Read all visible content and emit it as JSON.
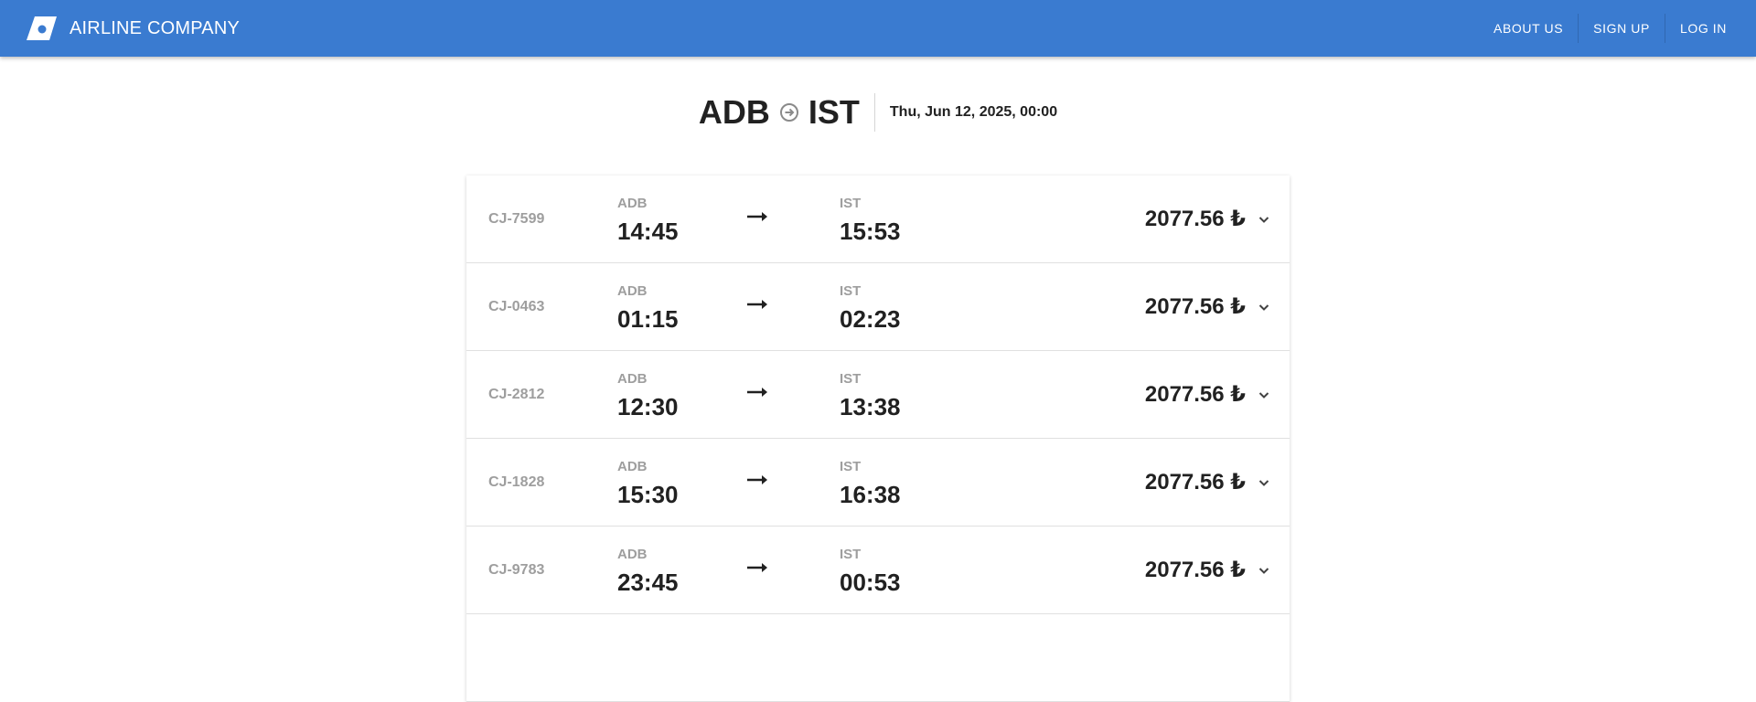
{
  "header": {
    "brand": "AIRLINE COMPANY",
    "nav": [
      "ABOUT US",
      "SIGN UP",
      "LOG IN"
    ],
    "color": "#3a7bd0"
  },
  "search": {
    "origin": "ADB",
    "destination": "IST",
    "date": "Thu, Jun 12, 2025, 00:00"
  },
  "flights": [
    {
      "code": "CJ-7599",
      "dep_airport": "ADB",
      "dep_time": "14:45",
      "arr_airport": "IST",
      "arr_time": "15:53",
      "price": "2077.56 ₺"
    },
    {
      "code": "CJ-0463",
      "dep_airport": "ADB",
      "dep_time": "01:15",
      "arr_airport": "IST",
      "arr_time": "02:23",
      "price": "2077.56 ₺"
    },
    {
      "code": "CJ-2812",
      "dep_airport": "ADB",
      "dep_time": "12:30",
      "arr_airport": "IST",
      "arr_time": "13:38",
      "price": "2077.56 ₺"
    },
    {
      "code": "CJ-1828",
      "dep_airport": "ADB",
      "dep_time": "15:30",
      "arr_airport": "IST",
      "arr_time": "16:38",
      "price": "2077.56 ₺"
    },
    {
      "code": "CJ-9783",
      "dep_airport": "ADB",
      "dep_time": "23:45",
      "arr_airport": "IST",
      "arr_time": "00:53",
      "price": "2077.56 ₺"
    },
    {
      "code": "",
      "dep_airport": "",
      "dep_time": "",
      "arr_airport": "",
      "arr_time": "",
      "price": ""
    }
  ]
}
